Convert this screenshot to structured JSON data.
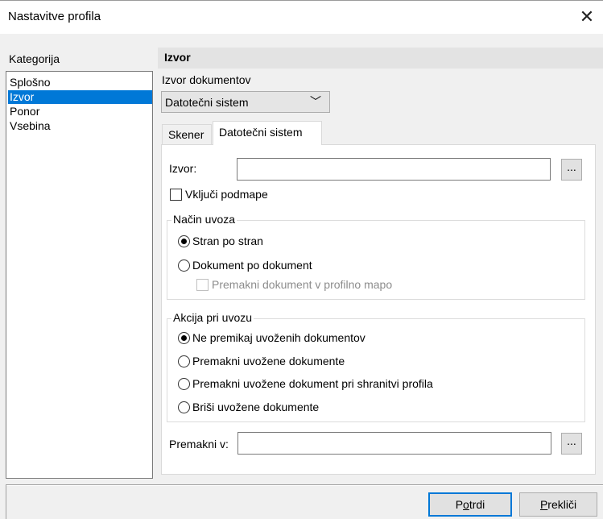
{
  "window": {
    "title": "Nastavitve profila",
    "close_glyph": "✕"
  },
  "category": {
    "header": "Kategorija",
    "items": [
      {
        "label": "Splošno",
        "selected": false
      },
      {
        "label": "Izvor",
        "selected": true
      },
      {
        "label": "Ponor",
        "selected": false
      },
      {
        "label": "Vsebina",
        "selected": false
      }
    ]
  },
  "section": {
    "title": "Izvor"
  },
  "source_doc": {
    "label": "Izvor dokumentov",
    "value": "Datotečni sistem",
    "chevron": "﹀"
  },
  "tabs": [
    {
      "label": "Skener",
      "active": false
    },
    {
      "label": "Datotečni sistem",
      "active": true
    }
  ],
  "filesystem": {
    "source_label": "Izvor:",
    "source_value": "",
    "browse_label": "...",
    "include_subfolders": {
      "label": "Vključi podmape",
      "checked": false
    }
  },
  "import_mode": {
    "legend": "Način uvoza",
    "options": [
      {
        "label": "Stran po stran",
        "checked": true
      },
      {
        "label": "Dokument po dokument",
        "checked": false
      }
    ],
    "move_to_profile": {
      "label": "Premakni dokument v profilno mapo",
      "checked": false,
      "disabled": true
    }
  },
  "import_action": {
    "legend": "Akcija pri uvozu",
    "options": [
      {
        "label": "Ne premikaj uvoženih dokumentov",
        "checked": true
      },
      {
        "label": "Premakni uvožene dokumente",
        "checked": false
      },
      {
        "label": "Premakni uvožene dokument pri shranitvi profila",
        "checked": false
      },
      {
        "label": "Briši uvožene dokumente",
        "checked": false
      }
    ]
  },
  "move_to": {
    "label": "Premakni v:",
    "value": "",
    "browse_label": "..."
  },
  "buttons": {
    "confirm": {
      "pre": "P",
      "accel": "o",
      "post": "trdi"
    },
    "cancel": {
      "pre": "",
      "accel": "P",
      "post": "rekliči"
    }
  }
}
